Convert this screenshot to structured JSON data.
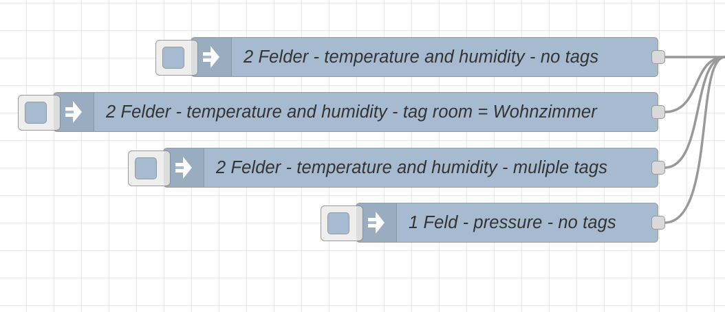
{
  "flow": {
    "nodes": [
      {
        "type": "inject",
        "label": "2 Felder - temperature and humidity - no tags",
        "icon": "arrow-in-icon"
      },
      {
        "type": "inject",
        "label": "2 Felder - temperature and humidity - tag room = Wohnzimmer",
        "icon": "arrow-in-icon"
      },
      {
        "type": "inject",
        "label": "2 Felder - temperature and humidity - muliple tags",
        "icon": "arrow-in-icon"
      },
      {
        "type": "inject",
        "label": "1 Feld - pressure - no tags",
        "icon": "arrow-in-icon"
      }
    ]
  },
  "colors": {
    "node_fill": "#a6bbcf",
    "node_border": "#999999",
    "wire": "#999999",
    "grid": "#e9e9e9",
    "background": "#ffffff"
  }
}
